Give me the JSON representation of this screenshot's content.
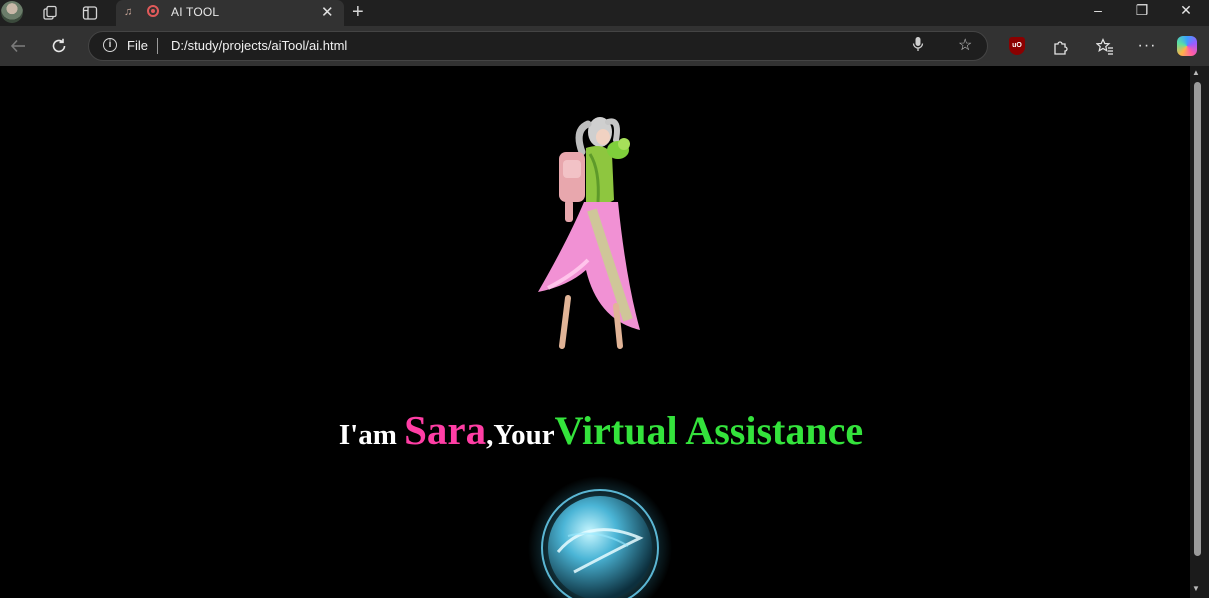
{
  "browser": {
    "tab": {
      "title": "AI TOOL",
      "close_glyph": "✕"
    },
    "new_tab_glyph": "+",
    "window_controls": {
      "minimize": "–",
      "restore": "❐",
      "close": "✕"
    },
    "address_bar": {
      "scheme_label": "File",
      "url": "D:/study/projects/aiTool/ai.html"
    },
    "icons": [
      "profile-avatar",
      "workspaces-icon",
      "tab-actions-icon",
      "back-icon",
      "refresh-icon",
      "info-icon",
      "microphone-icon",
      "favorite-star-icon",
      "ublock-icon",
      "extensions-icon",
      "favorites-icon",
      "more-menu-icon",
      "copilot-icon"
    ],
    "ublock_text": "uO"
  },
  "page": {
    "heading": {
      "part1": "I'am ",
      "part2": "Sara",
      "part3": ",Your",
      "part4": "Virtual Assistance"
    },
    "colors": {
      "background": "#000000",
      "name": "#ff3ea5",
      "accent": "#34e33c",
      "text": "#ffffff"
    }
  }
}
